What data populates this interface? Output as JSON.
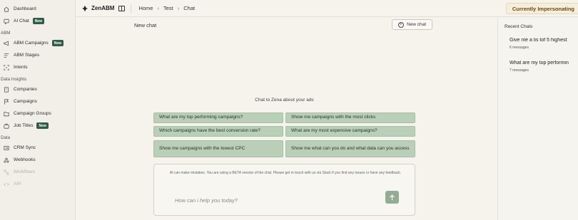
{
  "sidebar": {
    "items_top": [
      {
        "label": "Dashboard",
        "icon": "home-icon"
      },
      {
        "label": "AI Chat",
        "icon": "chat-icon",
        "badge": "New"
      }
    ],
    "sections": [
      {
        "title": "ABM",
        "items": [
          {
            "label": "ABM Campaigns",
            "icon": "megaphone-icon",
            "badge": "New"
          },
          {
            "label": "ABM Stages",
            "icon": "stages-icon"
          },
          {
            "label": "Intents",
            "icon": "target-icon"
          }
        ]
      },
      {
        "title": "Data Insights",
        "items": [
          {
            "label": "Companies",
            "icon": "building-icon"
          },
          {
            "label": "Campaigns",
            "icon": "flag-icon"
          },
          {
            "label": "Campaign Groups",
            "icon": "folder-icon"
          },
          {
            "label": "Job Titles",
            "icon": "briefcase-icon",
            "badge": "New"
          }
        ]
      },
      {
        "title": "Data",
        "items": [
          {
            "label": "CRM Sync",
            "icon": "sync-icon"
          },
          {
            "label": "Webhooks",
            "icon": "webhook-icon"
          },
          {
            "label": "Workflows",
            "icon": "workflow-icon",
            "disabled": true
          },
          {
            "label": "API",
            "icon": "code-icon",
            "disabled": true
          }
        ]
      }
    ]
  },
  "header": {
    "brand": "ZenABM",
    "breadcrumbs": [
      "Home",
      "Test",
      "Chat"
    ],
    "impersonation": "Currently Impersonating"
  },
  "chat": {
    "title": "New chat",
    "new_chat_label": "New chat",
    "heading": "Chat to Zena about your ads",
    "suggestions": [
      "What are my top performing campaigns?",
      "Show me campaigns with the most clicks",
      "Which campaigns have the best conversion rate?",
      "What are my most expensive campaigns?",
      "Show me campaigns with the lowest CPC",
      "Show me what can you do and what data can you access"
    ],
    "notice": "AI can make mistakes. You are using a BETA version of the chat. Please get in touch with us via Slack if you find any issues or have any feedback.",
    "input_placeholder": "How can i help you today?"
  },
  "recent": {
    "title": "Recent Chats",
    "items": [
      {
        "question": "Give me a lis tof 5 highest",
        "count": "6 messages"
      },
      {
        "question": "What are my top performin",
        "count": "7 messages"
      }
    ]
  },
  "colors": {
    "accent": "#2f5c47",
    "suggestion_bg": "#b9cfb8",
    "send_button": "#8fae95",
    "impersonation_bg": "#f6eedc"
  }
}
